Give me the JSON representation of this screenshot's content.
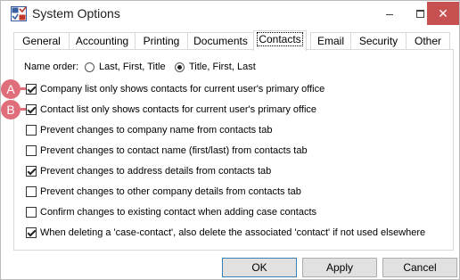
{
  "window": {
    "title": "System Options",
    "close_glyph": "✕"
  },
  "tabs": [
    {
      "label": "General"
    },
    {
      "label": "Accounting"
    },
    {
      "label": "Printing"
    },
    {
      "label": "Documents"
    },
    {
      "label": "Contacts",
      "active": true
    },
    {
      "label": "Email"
    },
    {
      "label": "Security"
    },
    {
      "label": "Other"
    }
  ],
  "name_order": {
    "label": "Name order:",
    "options": [
      {
        "label": "Last, First, Title",
        "selected": false
      },
      {
        "label": "Title, First, Last",
        "selected": true
      }
    ]
  },
  "checkboxes": [
    {
      "label": "Company list only shows contacts for current user's primary office",
      "checked": true,
      "marker": "A"
    },
    {
      "label": "Contact list only shows contacts for current user's primary office",
      "checked": true,
      "marker": "B"
    },
    {
      "label": "Prevent changes to company name from contacts tab",
      "checked": false
    },
    {
      "label": "Prevent changes to contact name (first/last) from contacts tab",
      "checked": false
    },
    {
      "label": "Prevent changes to address details from contacts tab",
      "checked": true
    },
    {
      "label": "Prevent changes to other company details from contacts tab",
      "checked": false
    },
    {
      "label": "Confirm changes to existing contact when adding case contacts",
      "checked": false
    },
    {
      "label": "When deleting a 'case-contact', also delete the associated 'contact' if not used elsewhere",
      "checked": true
    }
  ],
  "buttons": {
    "ok": "OK",
    "apply": "Apply",
    "cancel": "Cancel"
  },
  "colors": {
    "marker": "#e06e7a",
    "close": "#c75050"
  }
}
